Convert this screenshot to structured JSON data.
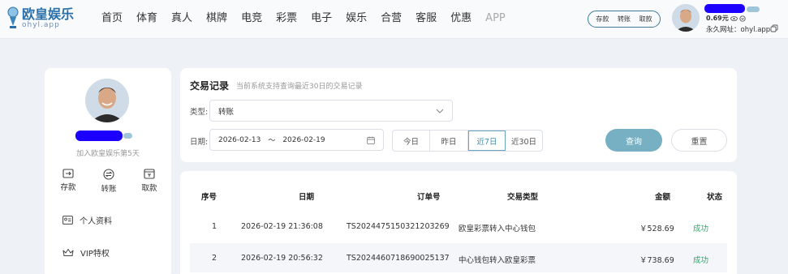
{
  "brand": {
    "name": "欧皇娱乐",
    "sub": "ohyl.app"
  },
  "nav": [
    "首页",
    "体育",
    "真人",
    "棋牌",
    "电竞",
    "彩票",
    "电子",
    "娱乐",
    "合营",
    "客服",
    "优惠",
    "APP"
  ],
  "wallet": {
    "deposit": "存款",
    "transfer": "转账",
    "withdraw": "取款"
  },
  "header_user": {
    "balance": "0.69元",
    "url_label": "永久网址：",
    "url": "ohyl.app"
  },
  "sidebar": {
    "join_text": "加入欧皇娱乐第5天",
    "actions": [
      {
        "label": "存款",
        "icon": "deposit-icon"
      },
      {
        "label": "转账",
        "icon": "transfer-icon"
      },
      {
        "label": "取款",
        "icon": "withdraw-icon"
      }
    ],
    "links": [
      {
        "label": "个人资料",
        "icon": "profile-icon"
      },
      {
        "label": "VIP特权",
        "icon": "crown-icon"
      }
    ]
  },
  "filter": {
    "title": "交易记录",
    "subtitle": "当前系统支持查询最近30日的交易记录",
    "type_label": "类型:",
    "type_value": "转账",
    "date_label": "日期:",
    "date_start": "2026-02-13",
    "date_sep": "～",
    "date_end": "2026-02-19",
    "periods": [
      "今日",
      "昨日",
      "近7日",
      "近30日"
    ],
    "active_period": "近7日",
    "query": "查询",
    "reset": "重置"
  },
  "table": {
    "headers": [
      "序号",
      "日期",
      "订单号",
      "交易类型",
      "金额",
      "状态"
    ],
    "rows": [
      {
        "no": "1",
        "date": "2026-02-19 21:36:08",
        "order": "TS2024475150321203269",
        "type": "欧皇彩票转入中心钱包",
        "amount": "￥528.69",
        "status": "成功"
      },
      {
        "no": "2",
        "date": "2026-02-19 20:56:32",
        "order": "TS2024460718690025137",
        "type": "中心钱包转入欧皇彩票",
        "amount": "￥738.69",
        "status": "成功"
      }
    ]
  },
  "colors": {
    "accent": "#76b0c2",
    "success": "#2fa66a",
    "brand": "#2a6fa8",
    "redaction": "#1b00ff"
  }
}
